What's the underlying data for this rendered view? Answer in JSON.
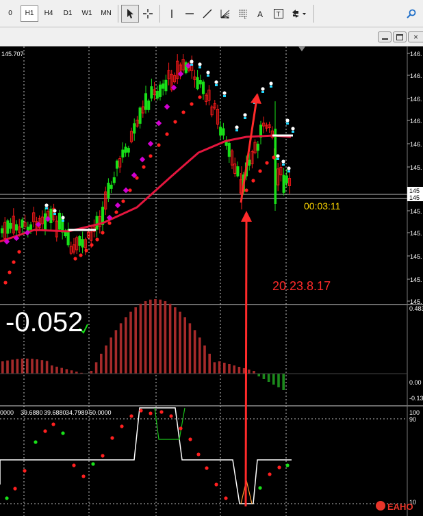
{
  "toolbar": {
    "timeframes": [
      {
        "label": "0",
        "active": false
      },
      {
        "label": "H1",
        "active": true
      },
      {
        "label": "H4",
        "active": false
      },
      {
        "label": "D1",
        "active": false
      },
      {
        "label": "W1",
        "active": false
      },
      {
        "label": "MN",
        "active": false
      }
    ],
    "tools": [
      "cursor-icon",
      "crosshair-icon",
      "vertical-line-icon",
      "horizontal-line-icon",
      "trendline-icon",
      "fibonacci-fan-icon",
      "fibonacci-retracement-icon",
      "text-icon",
      "text-label-icon",
      "arrows-icon"
    ]
  },
  "chart": {
    "top_left_price": "145.707",
    "price_axis": [
      "146.",
      "146.",
      "146.",
      "146.",
      "146.",
      "145.",
      "145.",
      "145.",
      "145.",
      "145.",
      "145.",
      "145."
    ],
    "current_price_tags": [
      "145",
      "145"
    ],
    "countdown": "00:03:11",
    "annotation_text": "20.23.8.17",
    "oscillator_value": "-0.052",
    "macd_axis": [
      "0.483",
      "0.00",
      "-0.13"
    ],
    "stoch_header": [
      "0000",
      "39.6880",
      "39.6880",
      "34.7989",
      "50.0000"
    ],
    "stoch_axis": [
      "100",
      "90",
      "10"
    ],
    "watermark": "EAHO",
    "colors": {
      "bull": "#19e019",
      "bear": "#ff1a1a",
      "ma": "#e4163e",
      "histogram": "#a52a2a",
      "annotation": "#ff2a2a",
      "countdown": "#ffd700"
    }
  }
}
